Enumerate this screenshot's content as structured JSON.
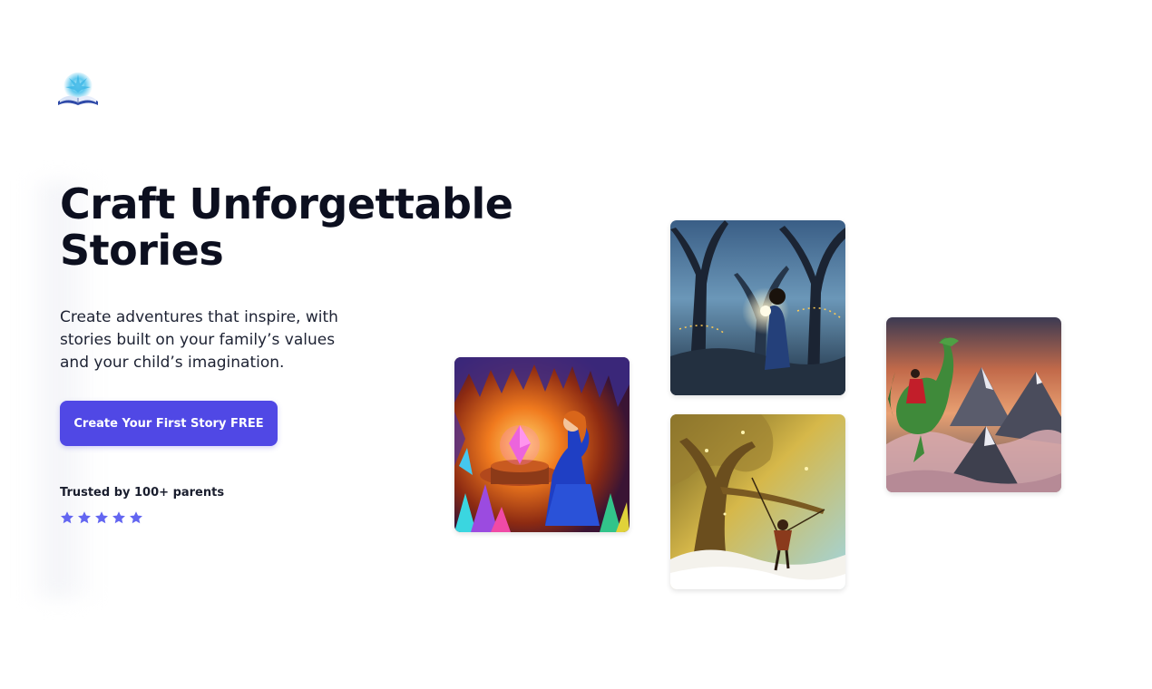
{
  "brand": {
    "logo_icon": "open-book-glow-icon"
  },
  "hero": {
    "title_line1": "Craft Unforgettable",
    "title_line2": "Stories",
    "subtitle": "Create adventures that inspire, with stories built on your family’s values and your child’s imagination.",
    "cta_label": "Create Your First Story FREE",
    "trust_text": "Trusted by 100+ parents",
    "rating_stars": 5,
    "star_icon": "star-icon"
  },
  "gallery": {
    "images": [
      {
        "scene": "princess-crystal-cave"
      },
      {
        "scene": "child-enchanted-forest-lantern"
      },
      {
        "scene": "boy-swinging-golden-tree"
      },
      {
        "scene": "girl-riding-dragon-mountains"
      }
    ]
  },
  "colors": {
    "accent": "#5048e5",
    "heading": "#0c0f1f",
    "body_text": "#1d2233",
    "star": "#6366f1",
    "background": "#ffffff"
  }
}
